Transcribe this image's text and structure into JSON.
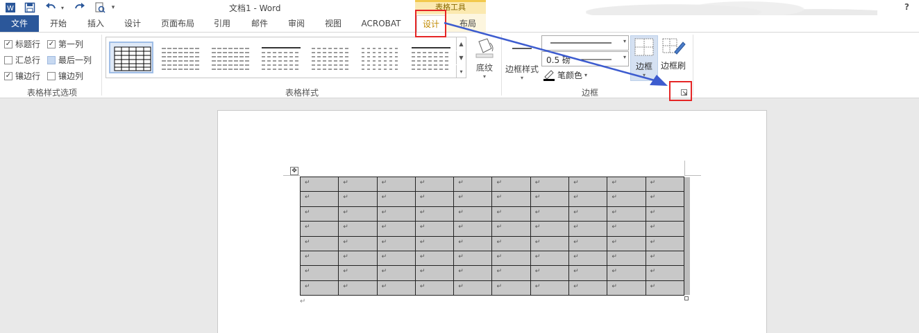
{
  "window": {
    "title": "文档1 - Word",
    "help": "?"
  },
  "qat": {
    "word_icon": "W",
    "undo_caret": "▾",
    "customize": "▾"
  },
  "context": {
    "header": "表格工具"
  },
  "tabs": [
    {
      "label": "文件"
    },
    {
      "label": "开始"
    },
    {
      "label": "插入"
    },
    {
      "label": "设计"
    },
    {
      "label": "页面布局"
    },
    {
      "label": "引用"
    },
    {
      "label": "邮件"
    },
    {
      "label": "审阅"
    },
    {
      "label": "视图"
    },
    {
      "label": "ACROBAT"
    },
    {
      "label": "设计",
      "context": true
    },
    {
      "label": "布局",
      "context": true
    }
  ],
  "style_options": {
    "header_row": "标题行",
    "total_row": "汇总行",
    "banded_rows": "镶边行",
    "first_column": "第一列",
    "last_column": "最后一列",
    "banded_columns": "镶边列",
    "group_label": "表格样式选项",
    "checked": {
      "header_row": true,
      "total_row": false,
      "banded_rows": true,
      "first_column": true,
      "last_column": false,
      "banded_columns": false
    }
  },
  "table_styles": {
    "group_label": "表格样式",
    "shading": "底纹"
  },
  "borders": {
    "border_styles": "边框样式",
    "pen_weight": "0.5 磅",
    "pen_color": "笔颜色",
    "borders_btn": "边框",
    "painter_btn": "边框刷",
    "group_label": "边框"
  },
  "document": {
    "rows": 8,
    "cols": 10,
    "cell_mark": "↵",
    "para_mark": "↵",
    "move_handle": "✥"
  },
  "colors": {
    "file_tab": "#2b579a",
    "context_accent": "#f2c94c",
    "highlight": "#e52525",
    "arrow": "#3d5ccf",
    "cell_fill": "#c8c8c8"
  }
}
